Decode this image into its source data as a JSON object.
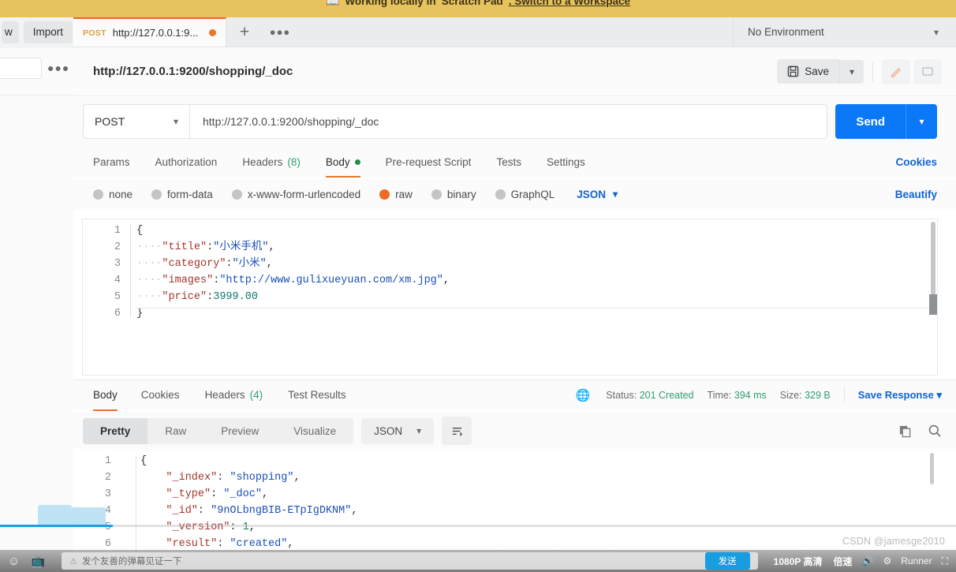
{
  "banner": {
    "icon": "book-icon",
    "text_before": "Working locally in ",
    "scratch": "Scratch Pad",
    "text_mid": ". Switch to a Workspace"
  },
  "left_rail": {
    "new_button": "w",
    "import_button": "Import",
    "more_menu": "●●●"
  },
  "tabstrip": {
    "tab": {
      "method": "POST",
      "name": "http://127.0.0.1:9...",
      "unsaved_dot": "●"
    },
    "new_tab": "+",
    "tab_options": "●●●",
    "environment": "No Environment"
  },
  "request_header": {
    "title": "http://127.0.0.1:9200/shopping/_doc",
    "save_label": "Save",
    "save_icon": "floppy-disk-icon",
    "edit_icon": "pencil-icon",
    "comment_icon": "comment-icon"
  },
  "url_bar": {
    "method": "POST",
    "url": "http://127.0.0.1:9200/shopping/_doc",
    "send_label": "Send"
  },
  "request_tabs": {
    "items": [
      {
        "label": "Params",
        "count": "",
        "dot": false,
        "active": false
      },
      {
        "label": "Authorization",
        "count": "",
        "dot": false,
        "active": false
      },
      {
        "label": "Headers",
        "count": "(8)",
        "dot": false,
        "active": false
      },
      {
        "label": "Body",
        "count": "",
        "dot": true,
        "active": true
      },
      {
        "label": "Pre-request Script",
        "count": "",
        "dot": false,
        "active": false
      },
      {
        "label": "Tests",
        "count": "",
        "dot": false,
        "active": false
      },
      {
        "label": "Settings",
        "count": "",
        "dot": false,
        "active": false
      }
    ],
    "cookies_link": "Cookies"
  },
  "body_types": {
    "options": [
      {
        "label": "none",
        "selected": false
      },
      {
        "label": "form-data",
        "selected": false
      },
      {
        "label": "x-www-form-urlencoded",
        "selected": false
      },
      {
        "label": "raw",
        "selected": true
      },
      {
        "label": "binary",
        "selected": false
      },
      {
        "label": "GraphQL",
        "selected": false
      }
    ],
    "format": "JSON",
    "beautify": "Beautify"
  },
  "request_body": {
    "line_numbers": [
      "1",
      "2",
      "3",
      "4",
      "5",
      "6"
    ],
    "lines": [
      {
        "indent": "",
        "tokens": [
          {
            "t": "brace",
            "v": "{"
          }
        ]
      },
      {
        "indent": "····",
        "tokens": [
          {
            "t": "k",
            "v": "\"title\""
          },
          {
            "t": "p",
            "v": ":"
          },
          {
            "t": "s",
            "v": "\"小米手机\""
          },
          {
            "t": "p",
            "v": ","
          }
        ]
      },
      {
        "indent": "····",
        "tokens": [
          {
            "t": "k",
            "v": "\"category\""
          },
          {
            "t": "p",
            "v": ":"
          },
          {
            "t": "s",
            "v": "\"小米\""
          },
          {
            "t": "p",
            "v": ","
          }
        ]
      },
      {
        "indent": "····",
        "tokens": [
          {
            "t": "k",
            "v": "\"images\""
          },
          {
            "t": "p",
            "v": ":"
          },
          {
            "t": "s",
            "v": "\"http://www.gulixueyuan.com/xm.jpg\""
          },
          {
            "t": "p",
            "v": ","
          }
        ]
      },
      {
        "indent": "····",
        "tokens": [
          {
            "t": "k",
            "v": "\"price\""
          },
          {
            "t": "p",
            "v": ":"
          },
          {
            "t": "n",
            "v": "3999.00"
          }
        ]
      },
      {
        "indent": "",
        "tokens": [
          {
            "t": "brace",
            "v": "}"
          }
        ]
      }
    ]
  },
  "response_tabs": {
    "items": [
      {
        "label": "Body",
        "count": "",
        "active": true
      },
      {
        "label": "Cookies",
        "count": "",
        "active": false
      },
      {
        "label": "Headers",
        "count": "(4)",
        "active": false
      },
      {
        "label": "Test Results",
        "count": "",
        "active": false
      }
    ],
    "status_label": "Status:",
    "status_value": "201 Created",
    "time_label": "Time:",
    "time_value": "394 ms",
    "size_label": "Size:",
    "size_value": "329 B",
    "save_response": "Save Response"
  },
  "response_toolbar": {
    "views": [
      {
        "label": "Pretty",
        "active": true
      },
      {
        "label": "Raw",
        "active": false
      },
      {
        "label": "Preview",
        "active": false
      },
      {
        "label": "Visualize",
        "active": false
      }
    ],
    "format": "JSON",
    "wrap_icon": "word-wrap-icon",
    "copy_icon": "copy-icon",
    "search_icon": "search-icon"
  },
  "response_body": {
    "line_numbers": [
      "1",
      "2",
      "3",
      "4",
      "5",
      "6"
    ],
    "lines": [
      {
        "indent": "",
        "tokens": [
          {
            "t": "brace",
            "v": "{"
          }
        ]
      },
      {
        "indent": "    ",
        "tokens": [
          {
            "t": "k",
            "v": "\"_index\""
          },
          {
            "t": "p",
            "v": ": "
          },
          {
            "t": "s",
            "v": "\"shopping\""
          },
          {
            "t": "p",
            "v": ","
          }
        ]
      },
      {
        "indent": "    ",
        "tokens": [
          {
            "t": "k",
            "v": "\"_type\""
          },
          {
            "t": "p",
            "v": ": "
          },
          {
            "t": "s",
            "v": "\"_doc\""
          },
          {
            "t": "p",
            "v": ","
          }
        ]
      },
      {
        "indent": "    ",
        "tokens": [
          {
            "t": "k",
            "v": "\"_id\""
          },
          {
            "t": "p",
            "v": ": "
          },
          {
            "t": "s",
            "v": "\"9nOLbngBIB-ETpIgDKNM\""
          },
          {
            "t": "p",
            "v": ","
          }
        ]
      },
      {
        "indent": "    ",
        "tokens": [
          {
            "t": "k",
            "v": "\"_version\""
          },
          {
            "t": "p",
            "v": ": "
          },
          {
            "t": "n",
            "v": "1"
          },
          {
            "t": "p",
            "v": ","
          }
        ]
      },
      {
        "indent": "    ",
        "tokens": [
          {
            "t": "k",
            "v": "\"result\""
          },
          {
            "t": "p",
            "v": ": "
          },
          {
            "t": "s",
            "v": "\"created\""
          },
          {
            "t": "p",
            "v": ","
          }
        ]
      }
    ]
  },
  "video_overlay": {
    "comment_placeholder": "发个友善的弹幕见证一下",
    "send_label": "发送",
    "quality": "1080P 高清",
    "speed": "倍速",
    "volume_icon": "volume-icon",
    "settings_icon": "gear-icon",
    "runner_label": "Runner",
    "fullscreen_icon": "fullscreen-icon"
  },
  "watermark": "CSDN @jamesge2010",
  "colors": {
    "accent_orange": "#e8762c",
    "send_blue": "#0b79f7",
    "link_blue": "#1165d4",
    "success_green": "#2f9e6e",
    "banner_yellow": "#e6c35c"
  }
}
